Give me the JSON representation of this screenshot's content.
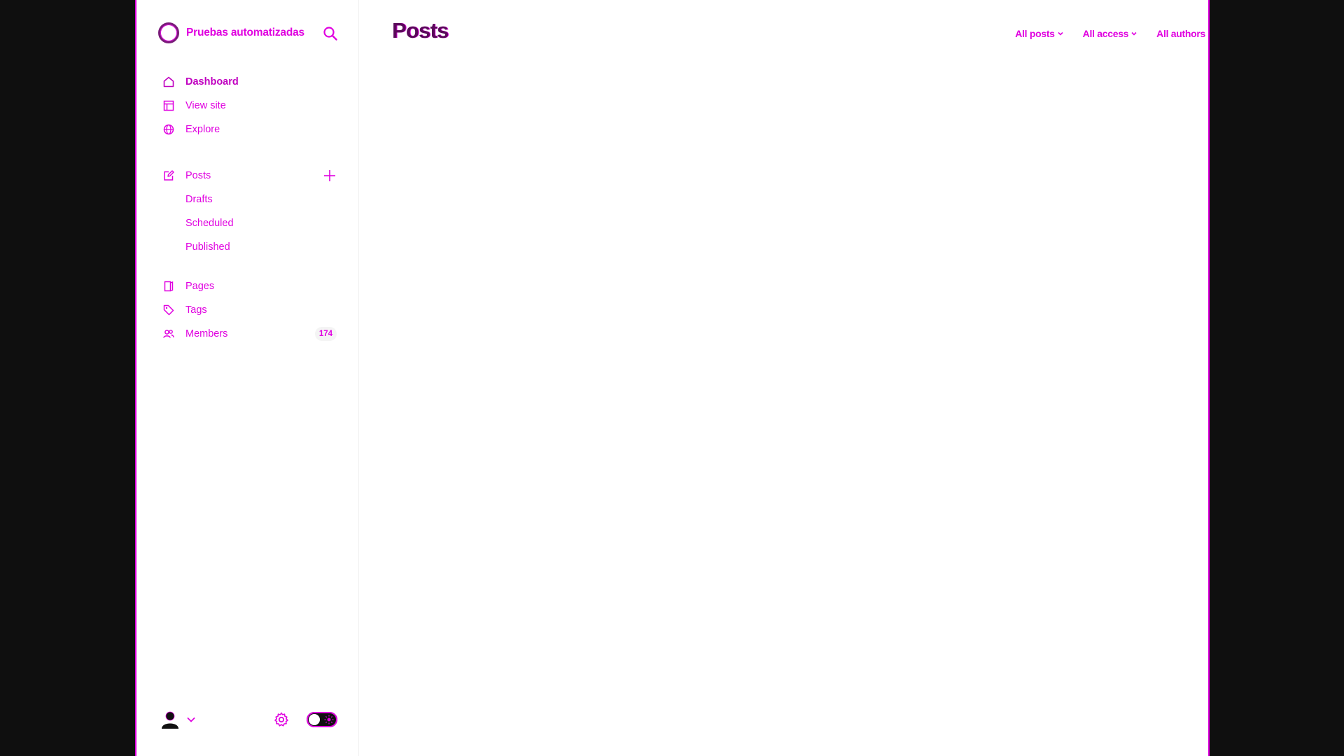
{
  "brand": {
    "name": "Pruebas automatizadas"
  },
  "nav": {
    "dashboard": "Dashboard",
    "view_site": "View site",
    "explore": "Explore",
    "posts": "Posts",
    "drafts": "Drafts",
    "scheduled": "Scheduled",
    "published": "Published",
    "pages": "Pages",
    "tags": "Tags",
    "members": "Members",
    "members_count": "174"
  },
  "main": {
    "title": "Posts",
    "filters": [
      "All posts",
      "All access",
      "All authors"
    ]
  },
  "colors": {
    "accent": "#e000e0",
    "title": "#5a0a5a",
    "background": "#ffffff",
    "frame": "#0f0f0f"
  },
  "icons": [
    "search-icon",
    "home-icon",
    "layout-icon",
    "globe-icon",
    "edit-icon",
    "plus-icon",
    "page-icon",
    "tag-icon",
    "members-icon",
    "user-avatar-icon",
    "chevron-down-icon",
    "gear-icon",
    "sun-icon"
  ]
}
